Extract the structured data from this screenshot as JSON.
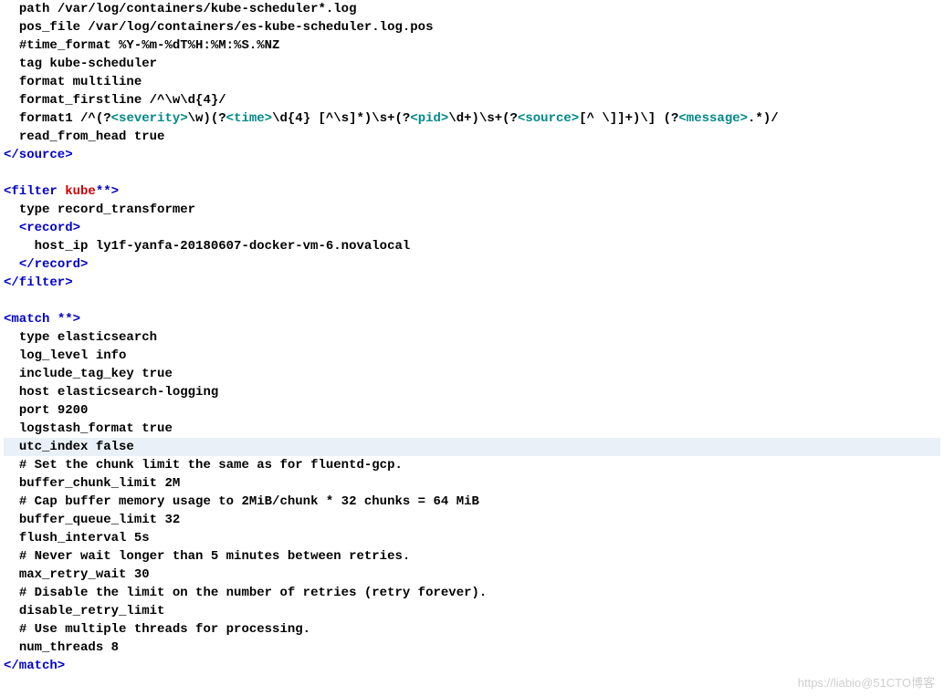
{
  "watermark": "https://liabio@51CTO博客",
  "highlight_index": 24,
  "lines": [
    {
      "indent": 1,
      "text": [
        {
          "c": "",
          "t": "path /var/log/containers/kube-scheduler*.log"
        }
      ]
    },
    {
      "indent": 1,
      "text": [
        {
          "c": "",
          "t": "pos_file /var/log/containers/es-kube-scheduler.log.pos"
        }
      ]
    },
    {
      "indent": 1,
      "text": [
        {
          "c": "",
          "t": "#time_format %Y-%m-%dT%H:%M:%S.%NZ"
        }
      ]
    },
    {
      "indent": 1,
      "text": [
        {
          "c": "",
          "t": "tag kube-scheduler"
        }
      ]
    },
    {
      "indent": 1,
      "text": [
        {
          "c": "",
          "t": "format multiline"
        }
      ]
    },
    {
      "indent": 1,
      "text": [
        {
          "c": "",
          "t": "format_firstline /^\\w\\d{4}/"
        }
      ]
    },
    {
      "indent": 1,
      "text": [
        {
          "c": "",
          "t": "format1 /^(?"
        },
        {
          "c": "t-grp",
          "t": "<severity>"
        },
        {
          "c": "",
          "t": "\\w)(?"
        },
        {
          "c": "t-grp",
          "t": "<time>"
        },
        {
          "c": "",
          "t": "\\d{4} [^\\s]*)\\s+(?"
        },
        {
          "c": "t-grp",
          "t": "<pid>"
        },
        {
          "c": "",
          "t": "\\d+)\\s+(?"
        },
        {
          "c": "t-grp",
          "t": "<source>"
        },
        {
          "c": "",
          "t": "[^ \\]]+)\\] (?"
        },
        {
          "c": "t-grp",
          "t": "<message>"
        },
        {
          "c": "",
          "t": ".*)/"
        }
      ]
    },
    {
      "indent": 1,
      "text": [
        {
          "c": "",
          "t": "read_from_head true"
        }
      ]
    },
    {
      "indent": 0,
      "text": [
        {
          "c": "t-tag",
          "t": "</source>"
        }
      ]
    },
    {
      "indent": 0,
      "text": [
        {
          "c": "",
          "t": ""
        }
      ]
    },
    {
      "indent": 0,
      "text": [
        {
          "c": "t-tag",
          "t": "<filter "
        },
        {
          "c": "t-kw",
          "t": "kube"
        },
        {
          "c": "t-tag",
          "t": "**>"
        }
      ]
    },
    {
      "indent": 1,
      "text": [
        {
          "c": "",
          "t": "type record_transformer"
        }
      ]
    },
    {
      "indent": 1,
      "text": [
        {
          "c": "t-tag",
          "t": "<record>"
        }
      ]
    },
    {
      "indent": 2,
      "text": [
        {
          "c": "",
          "t": "host_ip ly1f-yanfa-20180607-docker-vm-6.novalocal"
        }
      ]
    },
    {
      "indent": 1,
      "text": [
        {
          "c": "t-tag",
          "t": "</record>"
        }
      ]
    },
    {
      "indent": 0,
      "text": [
        {
          "c": "t-tag",
          "t": "</filter>"
        }
      ]
    },
    {
      "indent": 0,
      "text": [
        {
          "c": "",
          "t": ""
        }
      ]
    },
    {
      "indent": 0,
      "text": [
        {
          "c": "t-tag",
          "t": "<match "
        },
        {
          "c": "t-tag",
          "t": "**>"
        }
      ]
    },
    {
      "indent": 1,
      "text": [
        {
          "c": "",
          "t": "type elasticsearch"
        }
      ]
    },
    {
      "indent": 1,
      "text": [
        {
          "c": "",
          "t": "log_level info"
        }
      ]
    },
    {
      "indent": 1,
      "text": [
        {
          "c": "",
          "t": "include_tag_key true"
        }
      ]
    },
    {
      "indent": 1,
      "text": [
        {
          "c": "",
          "t": "host elasticsearch-logging"
        }
      ]
    },
    {
      "indent": 1,
      "text": [
        {
          "c": "",
          "t": "port 9200"
        }
      ]
    },
    {
      "indent": 1,
      "text": [
        {
          "c": "",
          "t": "logstash_format true"
        }
      ]
    },
    {
      "indent": 1,
      "text": [
        {
          "c": "",
          "t": "utc_index false"
        }
      ]
    },
    {
      "indent": 1,
      "text": [
        {
          "c": "",
          "t": "# Set the chunk limit the same as for fluentd-gcp."
        }
      ]
    },
    {
      "indent": 1,
      "text": [
        {
          "c": "",
          "t": "buffer_chunk_limit 2M"
        }
      ]
    },
    {
      "indent": 1,
      "text": [
        {
          "c": "",
          "t": "# Cap buffer memory usage to 2MiB/chunk * 32 chunks = 64 MiB"
        }
      ]
    },
    {
      "indent": 1,
      "text": [
        {
          "c": "",
          "t": "buffer_queue_limit 32"
        }
      ]
    },
    {
      "indent": 1,
      "text": [
        {
          "c": "",
          "t": "flush_interval 5s"
        }
      ]
    },
    {
      "indent": 1,
      "text": [
        {
          "c": "",
          "t": "# Never wait longer than 5 minutes between retries."
        }
      ]
    },
    {
      "indent": 1,
      "text": [
        {
          "c": "",
          "t": "max_retry_wait 30"
        }
      ]
    },
    {
      "indent": 1,
      "text": [
        {
          "c": "",
          "t": "# Disable the limit on the number of retries (retry forever)."
        }
      ]
    },
    {
      "indent": 1,
      "text": [
        {
          "c": "",
          "t": "disable_retry_limit"
        }
      ]
    },
    {
      "indent": 1,
      "text": [
        {
          "c": "",
          "t": "# Use multiple threads for processing."
        }
      ]
    },
    {
      "indent": 1,
      "text": [
        {
          "c": "",
          "t": "num_threads 8"
        }
      ]
    },
    {
      "indent": 0,
      "text": [
        {
          "c": "t-tag",
          "t": "</match>"
        }
      ]
    }
  ]
}
